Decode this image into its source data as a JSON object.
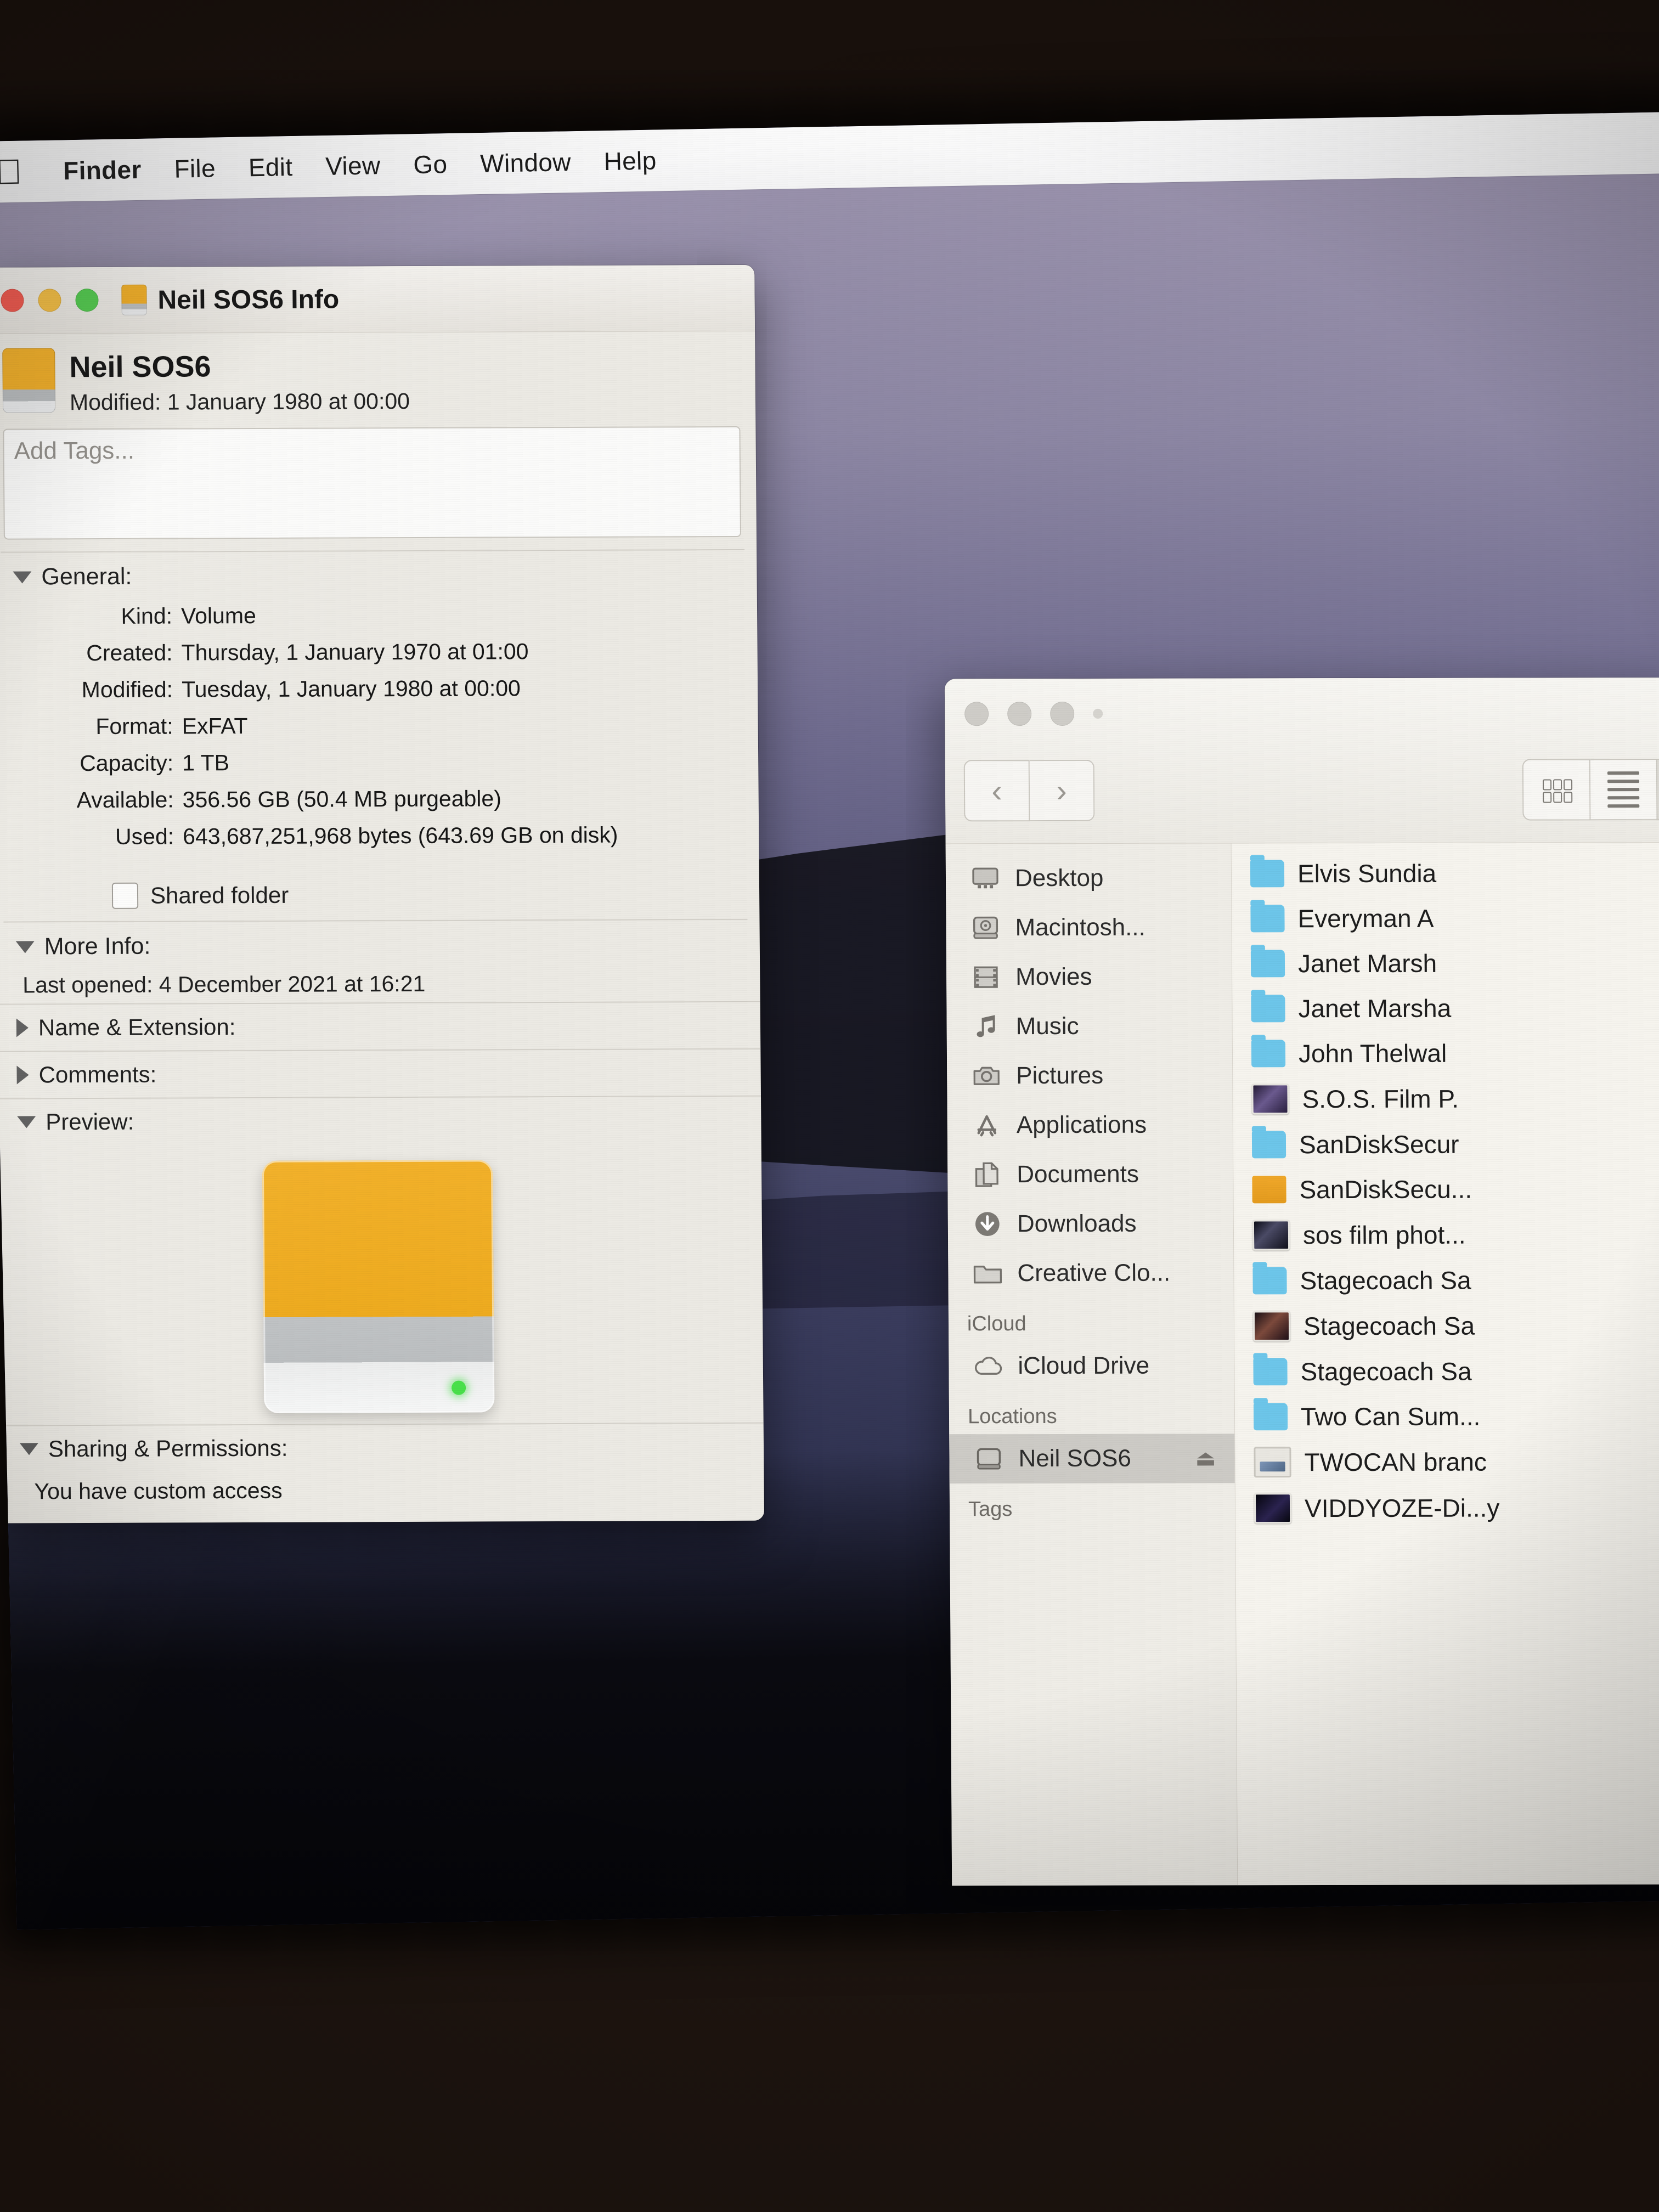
{
  "menubar": {
    "apple_icon": "apple-logo-icon",
    "items": [
      {
        "label": "Finder",
        "bold": true
      },
      {
        "label": "File",
        "bold": false
      },
      {
        "label": "Edit",
        "bold": false
      },
      {
        "label": "View",
        "bold": false
      },
      {
        "label": "Go",
        "bold": false
      },
      {
        "label": "Window",
        "bold": false
      },
      {
        "label": "Help",
        "bold": false
      }
    ]
  },
  "info_window": {
    "title": "Neil SOS6 Info",
    "volume_name": "Neil SOS6",
    "modified_summary": "Modified: 1 January 1980 at 00:00",
    "tags_placeholder": "Add Tags...",
    "general": {
      "heading": "General:",
      "rows": [
        {
          "key": "Kind:",
          "value": "Volume"
        },
        {
          "key": "Created:",
          "value": "Thursday, 1 January 1970 at 01:00"
        },
        {
          "key": "Modified:",
          "value": "Tuesday, 1 January 1980 at 00:00"
        },
        {
          "key": "Format:",
          "value": "ExFAT"
        },
        {
          "key": "Capacity:",
          "value": "1 TB"
        },
        {
          "key": "Available:",
          "value": "356.56 GB (50.4 MB purgeable)"
        },
        {
          "key": "Used:",
          "value": "643,687,251,968 bytes (643.69 GB on disk)"
        }
      ],
      "shared_folder_label": "Shared folder",
      "shared_folder_checked": false
    },
    "more_info": {
      "heading": "More Info:",
      "last_opened": "Last opened: 4 December 2021 at 16:21"
    },
    "name_extension_heading": "Name & Extension:",
    "comments_heading": "Comments:",
    "preview_heading": "Preview:",
    "sharing": {
      "heading": "Sharing & Permissions:",
      "access_text": "You have custom access"
    }
  },
  "finder_window": {
    "nav": {
      "back": "‹",
      "forward": "›"
    },
    "view_modes": [
      {
        "name": "icon-view",
        "active": false
      },
      {
        "name": "list-view",
        "active": false
      },
      {
        "name": "column-view",
        "active": true
      }
    ],
    "sidebar": {
      "favourites": [
        {
          "label": "Desktop",
          "icon": "desktop-icon"
        },
        {
          "label": "Macintosh...",
          "icon": "hard-drive-icon"
        },
        {
          "label": "Movies",
          "icon": "film-icon"
        },
        {
          "label": "Music",
          "icon": "music-note-icon"
        },
        {
          "label": "Pictures",
          "icon": "camera-icon"
        },
        {
          "label": "Applications",
          "icon": "app-store-icon"
        },
        {
          "label": "Documents",
          "icon": "documents-icon"
        },
        {
          "label": "Downloads",
          "icon": "download-icon"
        },
        {
          "label": "Creative Clo...",
          "icon": "folder-icon"
        }
      ],
      "icloud_group": "iCloud",
      "icloud_items": [
        {
          "label": "iCloud Drive",
          "icon": "cloud-icon"
        }
      ],
      "locations_group": "Locations",
      "locations_items": [
        {
          "label": "Neil SOS6",
          "icon": "external-drive-icon",
          "selected": true,
          "eject": "⏏"
        }
      ],
      "tags_group": "Tags"
    },
    "files": [
      {
        "name": "Elvis Sundia",
        "type": "folder"
      },
      {
        "name": "Everyman A",
        "type": "folder"
      },
      {
        "name": "Janet Marsh",
        "type": "folder"
      },
      {
        "name": "Janet Marsha",
        "type": "folder"
      },
      {
        "name": "John Thelwal",
        "type": "folder"
      },
      {
        "name": "S.O.S. Film P.",
        "type": "image-a"
      },
      {
        "name": "SanDiskSecur",
        "type": "folder"
      },
      {
        "name": "SanDiskSecu...",
        "type": "orange-app"
      },
      {
        "name": "sos film phot...",
        "type": "image-b"
      },
      {
        "name": "Stagecoach Sa",
        "type": "folder"
      },
      {
        "name": "Stagecoach Sa",
        "type": "image-c"
      },
      {
        "name": "Stagecoach Sa",
        "type": "folder"
      },
      {
        "name": "Two Can Sum...",
        "type": "folder"
      },
      {
        "name": "TWOCAN branc",
        "type": "document"
      },
      {
        "name": "VIDDYOZE-Di...y",
        "type": "image-d"
      }
    ]
  },
  "colors": {
    "drive_orange": "#f0ad24",
    "folder_blue": "#6dc6ea",
    "selection_grey": "#cdcbc6",
    "close_red": "#f05449",
    "minimise_yellow": "#f3bc3f",
    "maximise_green": "#4fc94b",
    "led_green": "#49e04a"
  }
}
